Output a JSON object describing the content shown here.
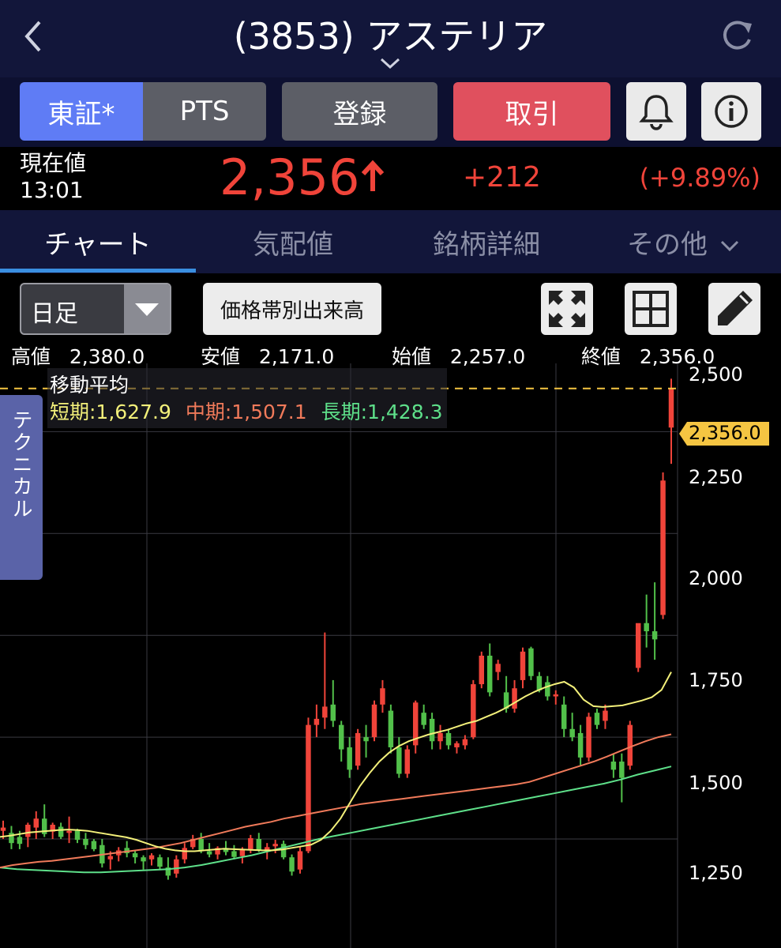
{
  "nav": {
    "title": "(3853) アステリア",
    "back_icon": "chevron-left-icon",
    "reload_icon": "refresh-icon"
  },
  "actions": {
    "market_tse": "東証*",
    "market_pts": "PTS",
    "register": "登録",
    "trade": "取引",
    "alert_icon": "bell-icon",
    "info_icon": "info-icon"
  },
  "quote": {
    "label": "現在値",
    "time": "13:01",
    "price": "2,356",
    "change": "+212",
    "change_pct": "(+9.89%)",
    "up_color": "#f0443a"
  },
  "tabs": {
    "chart": "チャート",
    "board": "気配値",
    "detail": "銘柄詳細",
    "other": "その他"
  },
  "tools": {
    "period": "日足",
    "volume_profile": "価格帯別出来高",
    "ohlc": {
      "high_label": "高値",
      "high": "2,380.0",
      "low_label": "安値",
      "low": "2,171.0",
      "open_label": "始値",
      "open": "2,257.0",
      "close_label": "終値",
      "close": "2,356.0"
    }
  },
  "chart": {
    "ma_title": "移動平均",
    "ma_short": "短期:1,627.9",
    "ma_mid": "中期:1,507.1",
    "ma_long": "長期:1,428.3",
    "technical_tab": "テクニカル",
    "current_tag": "2,356.0",
    "y_ticks": [
      "2,500",
      "2,250",
      "2,000",
      "1,750",
      "1,500",
      "1,250"
    ]
  },
  "chart_data": {
    "type": "candlestick",
    "y_range": [
      1200,
      2500
    ],
    "y_ticks": [
      1250,
      1500,
      1750,
      2000,
      2250,
      2500
    ],
    "colors": {
      "up": "#f0443a",
      "down": "#52c04a",
      "ma_short": "#f3f07a",
      "ma_mid": "#f07a5a",
      "ma_long": "#5ee08a"
    },
    "current_price": 2356,
    "candles": [
      [
        1270,
        1295,
        1250,
        1278
      ],
      [
        1265,
        1282,
        1225,
        1240
      ],
      [
        1255,
        1270,
        1225,
        1238
      ],
      [
        1255,
        1290,
        1230,
        1285
      ],
      [
        1278,
        1318,
        1250,
        1300
      ],
      [
        1300,
        1335,
        1255,
        1262
      ],
      [
        1268,
        1290,
        1250,
        1285
      ],
      [
        1280,
        1290,
        1250,
        1255
      ],
      [
        1265,
        1305,
        1240,
        1270
      ],
      [
        1270,
        1275,
        1240,
        1248
      ],
      [
        1250,
        1265,
        1225,
        1235
      ],
      [
        1245,
        1250,
        1220,
        1225
      ],
      [
        1235,
        1250,
        1180,
        1190
      ],
      [
        1200,
        1220,
        1175,
        1208
      ],
      [
        1210,
        1230,
        1195,
        1222
      ],
      [
        1228,
        1245,
        1205,
        1215
      ],
      [
        1215,
        1222,
        1190,
        1205
      ],
      [
        1205,
        1210,
        1175,
        1195
      ],
      [
        1200,
        1215,
        1185,
        1210
      ],
      [
        1205,
        1212,
        1175,
        1182
      ],
      [
        1180,
        1205,
        1150,
        1160
      ],
      [
        1165,
        1210,
        1155,
        1200
      ],
      [
        1200,
        1240,
        1190,
        1228
      ],
      [
        1230,
        1260,
        1225,
        1250
      ],
      [
        1250,
        1265,
        1215,
        1222
      ],
      [
        1220,
        1240,
        1205,
        1212
      ],
      [
        1212,
        1232,
        1200,
        1228
      ],
      [
        1228,
        1245,
        1210,
        1218
      ],
      [
        1220,
        1235,
        1200,
        1206
      ],
      [
        1208,
        1230,
        1190,
        1225
      ],
      [
        1225,
        1260,
        1215,
        1252
      ],
      [
        1250,
        1265,
        1218,
        1222
      ],
      [
        1222,
        1240,
        1200,
        1230
      ],
      [
        1232,
        1248,
        1215,
        1238
      ],
      [
        1238,
        1246,
        1200,
        1205
      ],
      [
        1205,
        1212,
        1160,
        1170
      ],
      [
        1175,
        1230,
        1165,
        1220
      ],
      [
        1220,
        1548,
        1215,
        1530
      ],
      [
        1530,
        1580,
        1500,
        1545
      ],
      [
        1548,
        1757,
        1520,
        1575
      ],
      [
        1580,
        1640,
        1525,
        1540
      ],
      [
        1530,
        1540,
        1440,
        1470
      ],
      [
        1475,
        1500,
        1400,
        1420
      ],
      [
        1430,
        1520,
        1420,
        1510
      ],
      [
        1500,
        1530,
        1450,
        1490
      ],
      [
        1500,
        1590,
        1490,
        1580
      ],
      [
        1580,
        1640,
        1560,
        1620
      ],
      [
        1565,
        1580,
        1460,
        1475
      ],
      [
        1475,
        1500,
        1400,
        1410
      ],
      [
        1410,
        1480,
        1400,
        1470
      ],
      [
        1480,
        1590,
        1460,
        1585
      ],
      [
        1560,
        1580,
        1520,
        1530
      ],
      [
        1545,
        1560,
        1470,
        1490
      ],
      [
        1490,
        1530,
        1470,
        1510
      ],
      [
        1510,
        1520,
        1470,
        1480
      ],
      [
        1475,
        1490,
        1460,
        1485
      ],
      [
        1480,
        1505,
        1470,
        1495
      ],
      [
        1500,
        1640,
        1495,
        1630
      ],
      [
        1630,
        1710,
        1620,
        1700
      ],
      [
        1700,
        1730,
        1600,
        1610
      ],
      [
        1660,
        1690,
        1640,
        1680
      ],
      [
        1610,
        1650,
        1560,
        1570
      ],
      [
        1570,
        1640,
        1560,
        1620
      ],
      [
        1640,
        1720,
        1620,
        1710
      ],
      [
        1718,
        1722,
        1640,
        1650
      ],
      [
        1650,
        1660,
        1610,
        1615
      ],
      [
        1635,
        1650,
        1590,
        1600
      ],
      [
        1600,
        1615,
        1580,
        1605
      ],
      [
        1580,
        1600,
        1500,
        1520
      ],
      [
        1520,
        1560,
        1490,
        1500
      ],
      [
        1510,
        1530,
        1430,
        1450
      ],
      [
        1450,
        1560,
        1440,
        1550
      ],
      [
        1560,
        1570,
        1520,
        1530
      ],
      [
        1540,
        1580,
        1520,
        1565
      ],
      [
        1440,
        1460,
        1400,
        1420
      ],
      [
        1440,
        1460,
        1340,
        1400
      ],
      [
        1430,
        1540,
        1420,
        1530
      ],
      [
        1670,
        1760,
        1660,
        1780
      ],
      [
        1780,
        1850,
        1720,
        1760
      ],
      [
        1760,
        1880,
        1690,
        1740
      ],
      [
        1800,
        2150,
        1790,
        2130
      ],
      [
        2260,
        2380,
        2171,
        2356
      ]
    ],
    "ma_short": [
      1255,
      1258,
      1262,
      1266,
      1268,
      1270,
      1272,
      1273,
      1272,
      1270,
      1266,
      1262,
      1258,
      1254,
      1248,
      1240,
      1232,
      1226,
      1222,
      1220,
      1220,
      1222,
      1224,
      1226,
      1225,
      1224,
      1223,
      1222,
      1222,
      1224,
      1228,
      1232,
      1236,
      1248,
      1270,
      1300,
      1340,
      1380,
      1412,
      1440,
      1462,
      1478,
      1490,
      1498,
      1506,
      1512,
      1518,
      1526,
      1534,
      1540,
      1550,
      1560,
      1572,
      1586,
      1600,
      1612,
      1622,
      1630,
      1636,
      1622,
      1592,
      1576,
      1574,
      1576,
      1578,
      1584,
      1590,
      1598,
      1616,
      1660
    ],
    "ma_mid": [
      1180,
      1186,
      1190,
      1194,
      1196,
      1200,
      1204,
      1208,
      1212,
      1216,
      1220,
      1224,
      1228,
      1234,
      1240,
      1248,
      1256,
      1264,
      1272,
      1280,
      1286,
      1292,
      1300,
      1306,
      1312,
      1318,
      1324,
      1330,
      1336,
      1340,
      1344,
      1348,
      1352,
      1356,
      1360,
      1364,
      1368,
      1372,
      1376,
      1380,
      1384,
      1390,
      1400,
      1410,
      1420,
      1430,
      1440,
      1452,
      1465,
      1478,
      1490,
      1500,
      1507
    ],
    "ma_long": [
      1180,
      1176,
      1174,
      1172,
      1170,
      1168,
      1168,
      1170,
      1172,
      1174,
      1176,
      1180,
      1186,
      1194,
      1202,
      1210,
      1220,
      1230,
      1240,
      1250,
      1258,
      1266,
      1274,
      1282,
      1290,
      1298,
      1306,
      1314,
      1322,
      1330,
      1338,
      1346,
      1354,
      1362,
      1370,
      1378,
      1386,
      1396,
      1408,
      1418,
      1428
    ]
  }
}
